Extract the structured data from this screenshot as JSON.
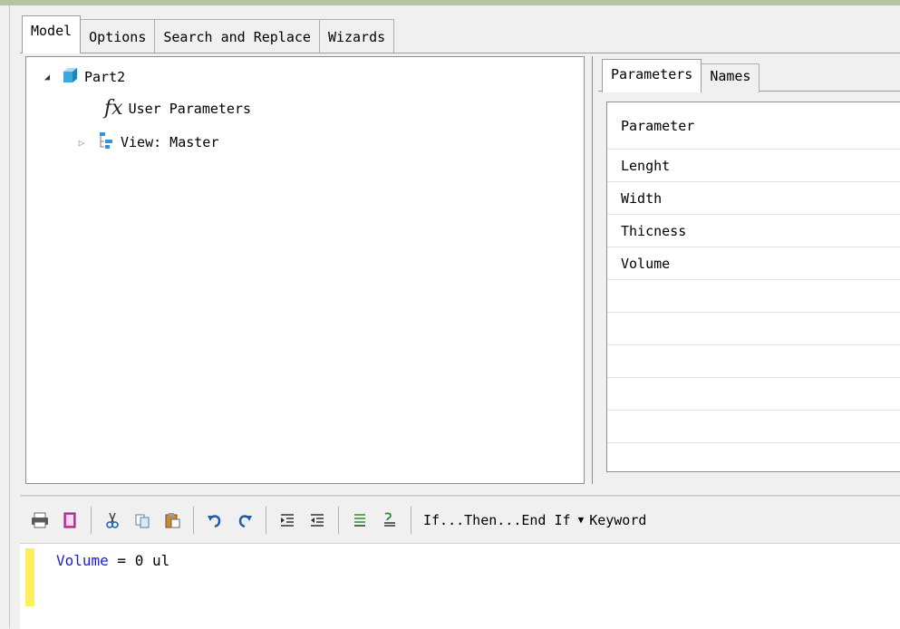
{
  "main_tabs": [
    {
      "label": "Model",
      "active": true
    },
    {
      "label": "Options",
      "active": false
    },
    {
      "label": "Search and Replace",
      "active": false
    },
    {
      "label": "Wizards",
      "active": false
    }
  ],
  "tree": {
    "root": {
      "label": "Part2",
      "expanded": true,
      "icon": "part-cube-icon"
    },
    "children": [
      {
        "label": "User Parameters",
        "icon": "fx-icon",
        "fx_glyph": "fx"
      },
      {
        "label": "View: Master",
        "icon": "view-tree-icon",
        "expanded": false
      }
    ]
  },
  "param_tabs": [
    {
      "label": "Parameters",
      "active": true
    },
    {
      "label": "Names",
      "active": false
    }
  ],
  "param_table": {
    "header": "Parameter",
    "rows": [
      "Lenght",
      "Width",
      "Thicness",
      "Volume"
    ]
  },
  "toolbar": {
    "icons": [
      "print-icon",
      "print-preview-icon",
      "cut-icon",
      "copy-icon",
      "paste-icon",
      "undo-icon",
      "redo-icon",
      "indent-icon",
      "outdent-icon",
      "comment-icon",
      "uncomment-icon"
    ],
    "snippet_label": "If...Then...End If",
    "keywords_label": "Keyword"
  },
  "editor": {
    "code_var": "Volume",
    "code_rest": " = 0 ul"
  },
  "colors": {
    "accent_strip": "#b5c4a2",
    "keyword_blue": "#1a1adc",
    "gutter_yellow": "#ffef5a"
  }
}
